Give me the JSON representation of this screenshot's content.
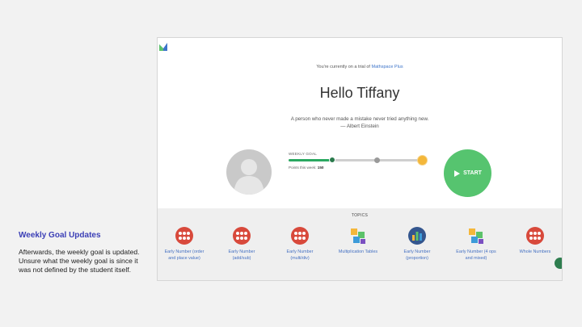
{
  "note": {
    "title": "Weekly Goal Updates",
    "body": "Afterwards, the weekly goal is updated. Unsure what the weekly goal is since it was not defined by the student itself."
  },
  "app": {
    "trial_prefix": "You're currently on a trial of",
    "trial_link": "Mathspace Plus",
    "greeting": "Hello Tiffany",
    "quote_line1": "A person who never made a mistake never tried anything new.",
    "quote_line2": "— Albert Einstein",
    "weekly_goal_label": "WEEKLY GOAL",
    "progress_fraction": 0.33,
    "points_label": "Points this week:",
    "points_value": "150",
    "start_label": "START"
  },
  "topics": {
    "title": "TOPICS",
    "items": [
      {
        "line1": "Early Number (order",
        "line2": "and place value)",
        "icon": "abacus-icon"
      },
      {
        "line1": "Early Number",
        "line2": "(add/sub)",
        "icon": "abacus-icon"
      },
      {
        "line1": "Early Number",
        "line2": "(multi/div)",
        "icon": "abacus-icon"
      },
      {
        "line1": "Multiplication Tables",
        "line2": "",
        "icon": "number-blocks-icon"
      },
      {
        "line1": "Early Number",
        "line2": "(proportion)",
        "icon": "bar-chart-icon"
      },
      {
        "line1": "Early Number (4 ops",
        "line2": "and mixed)",
        "icon": "number-blocks-icon"
      },
      {
        "line1": "Whole Numbers",
        "line2": "",
        "icon": "abacus-icon"
      }
    ]
  },
  "colors": {
    "accent": "#3b3fb6",
    "progress": "#2aa861",
    "start": "#56c46f",
    "topic_red": "#d8493b",
    "link": "#4470c2"
  }
}
